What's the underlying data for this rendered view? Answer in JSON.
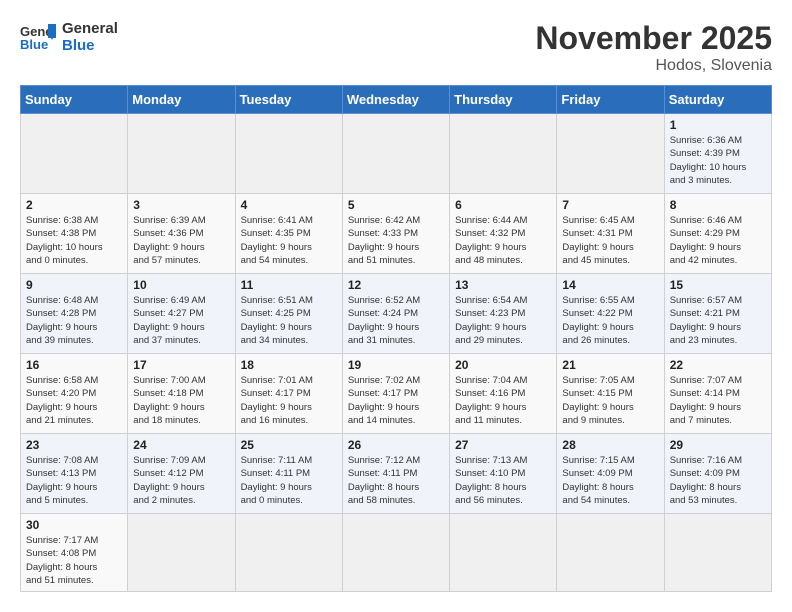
{
  "logo": {
    "general": "General",
    "blue": "Blue"
  },
  "title": "November 2025",
  "subtitle": "Hodos, Slovenia",
  "days_of_week": [
    "Sunday",
    "Monday",
    "Tuesday",
    "Wednesday",
    "Thursday",
    "Friday",
    "Saturday"
  ],
  "weeks": [
    [
      {
        "day": "",
        "info": ""
      },
      {
        "day": "",
        "info": ""
      },
      {
        "day": "",
        "info": ""
      },
      {
        "day": "",
        "info": ""
      },
      {
        "day": "",
        "info": ""
      },
      {
        "day": "",
        "info": ""
      },
      {
        "day": "1",
        "info": "Sunrise: 6:36 AM\nSunset: 4:39 PM\nDaylight: 10 hours\nand 3 minutes."
      }
    ],
    [
      {
        "day": "2",
        "info": "Sunrise: 6:38 AM\nSunset: 4:38 PM\nDaylight: 10 hours\nand 0 minutes."
      },
      {
        "day": "3",
        "info": "Sunrise: 6:39 AM\nSunset: 4:36 PM\nDaylight: 9 hours\nand 57 minutes."
      },
      {
        "day": "4",
        "info": "Sunrise: 6:41 AM\nSunset: 4:35 PM\nDaylight: 9 hours\nand 54 minutes."
      },
      {
        "day": "5",
        "info": "Sunrise: 6:42 AM\nSunset: 4:33 PM\nDaylight: 9 hours\nand 51 minutes."
      },
      {
        "day": "6",
        "info": "Sunrise: 6:44 AM\nSunset: 4:32 PM\nDaylight: 9 hours\nand 48 minutes."
      },
      {
        "day": "7",
        "info": "Sunrise: 6:45 AM\nSunset: 4:31 PM\nDaylight: 9 hours\nand 45 minutes."
      },
      {
        "day": "8",
        "info": "Sunrise: 6:46 AM\nSunset: 4:29 PM\nDaylight: 9 hours\nand 42 minutes."
      }
    ],
    [
      {
        "day": "9",
        "info": "Sunrise: 6:48 AM\nSunset: 4:28 PM\nDaylight: 9 hours\nand 39 minutes."
      },
      {
        "day": "10",
        "info": "Sunrise: 6:49 AM\nSunset: 4:27 PM\nDaylight: 9 hours\nand 37 minutes."
      },
      {
        "day": "11",
        "info": "Sunrise: 6:51 AM\nSunset: 4:25 PM\nDaylight: 9 hours\nand 34 minutes."
      },
      {
        "day": "12",
        "info": "Sunrise: 6:52 AM\nSunset: 4:24 PM\nDaylight: 9 hours\nand 31 minutes."
      },
      {
        "day": "13",
        "info": "Sunrise: 6:54 AM\nSunset: 4:23 PM\nDaylight: 9 hours\nand 29 minutes."
      },
      {
        "day": "14",
        "info": "Sunrise: 6:55 AM\nSunset: 4:22 PM\nDaylight: 9 hours\nand 26 minutes."
      },
      {
        "day": "15",
        "info": "Sunrise: 6:57 AM\nSunset: 4:21 PM\nDaylight: 9 hours\nand 23 minutes."
      }
    ],
    [
      {
        "day": "16",
        "info": "Sunrise: 6:58 AM\nSunset: 4:20 PM\nDaylight: 9 hours\nand 21 minutes."
      },
      {
        "day": "17",
        "info": "Sunrise: 7:00 AM\nSunset: 4:18 PM\nDaylight: 9 hours\nand 18 minutes."
      },
      {
        "day": "18",
        "info": "Sunrise: 7:01 AM\nSunset: 4:17 PM\nDaylight: 9 hours\nand 16 minutes."
      },
      {
        "day": "19",
        "info": "Sunrise: 7:02 AM\nSunset: 4:17 PM\nDaylight: 9 hours\nand 14 minutes."
      },
      {
        "day": "20",
        "info": "Sunrise: 7:04 AM\nSunset: 4:16 PM\nDaylight: 9 hours\nand 11 minutes."
      },
      {
        "day": "21",
        "info": "Sunrise: 7:05 AM\nSunset: 4:15 PM\nDaylight: 9 hours\nand 9 minutes."
      },
      {
        "day": "22",
        "info": "Sunrise: 7:07 AM\nSunset: 4:14 PM\nDaylight: 9 hours\nand 7 minutes."
      }
    ],
    [
      {
        "day": "23",
        "info": "Sunrise: 7:08 AM\nSunset: 4:13 PM\nDaylight: 9 hours\nand 5 minutes."
      },
      {
        "day": "24",
        "info": "Sunrise: 7:09 AM\nSunset: 4:12 PM\nDaylight: 9 hours\nand 2 minutes."
      },
      {
        "day": "25",
        "info": "Sunrise: 7:11 AM\nSunset: 4:11 PM\nDaylight: 9 hours\nand 0 minutes."
      },
      {
        "day": "26",
        "info": "Sunrise: 7:12 AM\nSunset: 4:11 PM\nDaylight: 8 hours\nand 58 minutes."
      },
      {
        "day": "27",
        "info": "Sunrise: 7:13 AM\nSunset: 4:10 PM\nDaylight: 8 hours\nand 56 minutes."
      },
      {
        "day": "28",
        "info": "Sunrise: 7:15 AM\nSunset: 4:09 PM\nDaylight: 8 hours\nand 54 minutes."
      },
      {
        "day": "29",
        "info": "Sunrise: 7:16 AM\nSunset: 4:09 PM\nDaylight: 8 hours\nand 53 minutes."
      }
    ],
    [
      {
        "day": "30",
        "info": "Sunrise: 7:17 AM\nSunset: 4:08 PM\nDaylight: 8 hours\nand 51 minutes."
      },
      {
        "day": "",
        "info": ""
      },
      {
        "day": "",
        "info": ""
      },
      {
        "day": "",
        "info": ""
      },
      {
        "day": "",
        "info": ""
      },
      {
        "day": "",
        "info": ""
      },
      {
        "day": "",
        "info": ""
      }
    ]
  ]
}
